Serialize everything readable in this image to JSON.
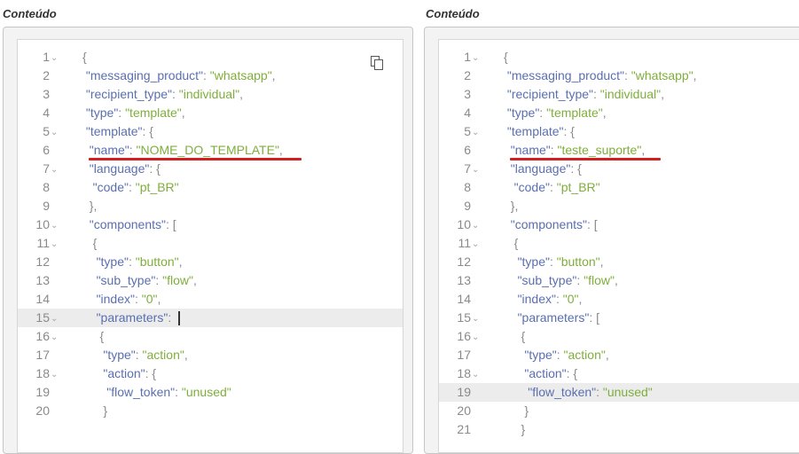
{
  "left": {
    "title": "Conteúdo",
    "highlight_line": 15,
    "lines": [
      {
        "n": "1",
        "fold": true,
        "parts": [
          [
            "p",
            "{"
          ]
        ]
      },
      {
        "n": "2",
        "fold": false,
        "parts": [
          [
            "p",
            " "
          ],
          [
            "k",
            "\"messaging_product\""
          ],
          [
            "p",
            ": "
          ],
          [
            "s",
            "\"whatsapp\""
          ],
          [
            "p",
            ","
          ]
        ]
      },
      {
        "n": "3",
        "fold": false,
        "parts": [
          [
            "p",
            " "
          ],
          [
            "k",
            "\"recipient_type\""
          ],
          [
            "p",
            ": "
          ],
          [
            "s",
            "\"individual\""
          ],
          [
            "p",
            ","
          ]
        ]
      },
      {
        "n": "4",
        "fold": false,
        "parts": [
          [
            "p",
            " "
          ],
          [
            "k",
            "\"type\""
          ],
          [
            "p",
            ": "
          ],
          [
            "s",
            "\"template\""
          ],
          [
            "p",
            ","
          ]
        ]
      },
      {
        "n": "5",
        "fold": true,
        "parts": [
          [
            "p",
            " "
          ],
          [
            "k",
            "\"template\""
          ],
          [
            "p",
            ": {"
          ]
        ]
      },
      {
        "n": "6",
        "fold": false,
        "parts": [
          [
            "p",
            "  "
          ],
          [
            "k",
            "\"name\""
          ],
          [
            "p",
            ": "
          ],
          [
            "s",
            "\"NOME_DO_TEMPLATE\""
          ],
          [
            "p",
            ","
          ]
        ]
      },
      {
        "n": "7",
        "fold": true,
        "parts": [
          [
            "p",
            "  "
          ],
          [
            "k",
            "\"language\""
          ],
          [
            "p",
            ": {"
          ]
        ]
      },
      {
        "n": "8",
        "fold": false,
        "parts": [
          [
            "p",
            "   "
          ],
          [
            "k",
            "\"code\""
          ],
          [
            "p",
            ": "
          ],
          [
            "s",
            "\"pt_BR\""
          ]
        ]
      },
      {
        "n": "9",
        "fold": false,
        "parts": [
          [
            "p",
            "  },"
          ]
        ]
      },
      {
        "n": "10",
        "fold": true,
        "parts": [
          [
            "p",
            "  "
          ],
          [
            "k",
            "\"components\""
          ],
          [
            "p",
            ": ["
          ]
        ]
      },
      {
        "n": "11",
        "fold": true,
        "parts": [
          [
            "p",
            "   {"
          ]
        ]
      },
      {
        "n": "12",
        "fold": false,
        "parts": [
          [
            "p",
            "    "
          ],
          [
            "k",
            "\"type\""
          ],
          [
            "p",
            ": "
          ],
          [
            "s",
            "\"button\""
          ],
          [
            "p",
            ","
          ]
        ]
      },
      {
        "n": "13",
        "fold": false,
        "parts": [
          [
            "p",
            "    "
          ],
          [
            "k",
            "\"sub_type\""
          ],
          [
            "p",
            ": "
          ],
          [
            "s",
            "\"flow\""
          ],
          [
            "p",
            ","
          ]
        ]
      },
      {
        "n": "14",
        "fold": false,
        "parts": [
          [
            "p",
            "    "
          ],
          [
            "k",
            "\"index\""
          ],
          [
            "p",
            ": "
          ],
          [
            "s",
            "\"0\""
          ],
          [
            "p",
            ","
          ]
        ]
      },
      {
        "n": "15",
        "fold": true,
        "parts": [
          [
            "p",
            "    "
          ],
          [
            "k",
            "\"parameters\""
          ],
          [
            "p",
            ": "
          ]
        ],
        "cursor": true
      },
      {
        "n": "16",
        "fold": true,
        "parts": [
          [
            "p",
            "     {"
          ]
        ]
      },
      {
        "n": "17",
        "fold": false,
        "parts": [
          [
            "p",
            "      "
          ],
          [
            "k",
            "\"type\""
          ],
          [
            "p",
            ": "
          ],
          [
            "s",
            "\"action\""
          ],
          [
            "p",
            ","
          ]
        ]
      },
      {
        "n": "18",
        "fold": true,
        "parts": [
          [
            "p",
            "      "
          ],
          [
            "k",
            "\"action\""
          ],
          [
            "p",
            ": {"
          ]
        ]
      },
      {
        "n": "19",
        "fold": false,
        "parts": [
          [
            "p",
            "       "
          ],
          [
            "k",
            "\"flow_token\""
          ],
          [
            "p",
            ": "
          ],
          [
            "s",
            "\"unused\""
          ]
        ]
      },
      {
        "n": "20",
        "fold": false,
        "parts": [
          [
            "p",
            "      }"
          ]
        ]
      }
    ]
  },
  "right": {
    "title": "Conteúdo",
    "highlight_line": 19,
    "lines": [
      {
        "n": "1",
        "fold": true,
        "parts": [
          [
            "p",
            "{"
          ]
        ]
      },
      {
        "n": "2",
        "fold": false,
        "parts": [
          [
            "p",
            " "
          ],
          [
            "k",
            "\"messaging_product\""
          ],
          [
            "p",
            ": "
          ],
          [
            "s",
            "\"whatsapp\""
          ],
          [
            "p",
            ","
          ]
        ]
      },
      {
        "n": "3",
        "fold": false,
        "parts": [
          [
            "p",
            " "
          ],
          [
            "k",
            "\"recipient_type\""
          ],
          [
            "p",
            ": "
          ],
          [
            "s",
            "\"individual\""
          ],
          [
            "p",
            ","
          ]
        ]
      },
      {
        "n": "4",
        "fold": false,
        "parts": [
          [
            "p",
            " "
          ],
          [
            "k",
            "\"type\""
          ],
          [
            "p",
            ": "
          ],
          [
            "s",
            "\"template\""
          ],
          [
            "p",
            ","
          ]
        ]
      },
      {
        "n": "5",
        "fold": true,
        "parts": [
          [
            "p",
            " "
          ],
          [
            "k",
            "\"template\""
          ],
          [
            "p",
            ": {"
          ]
        ]
      },
      {
        "n": "6",
        "fold": false,
        "parts": [
          [
            "p",
            "  "
          ],
          [
            "k",
            "\"name\""
          ],
          [
            "p",
            ": "
          ],
          [
            "s",
            "\"teste_suporte\""
          ],
          [
            "p",
            ","
          ]
        ]
      },
      {
        "n": "7",
        "fold": true,
        "parts": [
          [
            "p",
            "  "
          ],
          [
            "k",
            "\"language\""
          ],
          [
            "p",
            ": {"
          ]
        ]
      },
      {
        "n": "8",
        "fold": false,
        "parts": [
          [
            "p",
            "   "
          ],
          [
            "k",
            "\"code\""
          ],
          [
            "p",
            ": "
          ],
          [
            "s",
            "\"pt_BR\""
          ]
        ]
      },
      {
        "n": "9",
        "fold": false,
        "parts": [
          [
            "p",
            "  },"
          ]
        ]
      },
      {
        "n": "10",
        "fold": true,
        "parts": [
          [
            "p",
            "  "
          ],
          [
            "k",
            "\"components\""
          ],
          [
            "p",
            ": ["
          ]
        ]
      },
      {
        "n": "11",
        "fold": true,
        "parts": [
          [
            "p",
            "   {"
          ]
        ]
      },
      {
        "n": "12",
        "fold": false,
        "parts": [
          [
            "p",
            "    "
          ],
          [
            "k",
            "\"type\""
          ],
          [
            "p",
            ": "
          ],
          [
            "s",
            "\"button\""
          ],
          [
            "p",
            ","
          ]
        ]
      },
      {
        "n": "13",
        "fold": false,
        "parts": [
          [
            "p",
            "    "
          ],
          [
            "k",
            "\"sub_type\""
          ],
          [
            "p",
            ": "
          ],
          [
            "s",
            "\"flow\""
          ],
          [
            "p",
            ","
          ]
        ]
      },
      {
        "n": "14",
        "fold": false,
        "parts": [
          [
            "p",
            "    "
          ],
          [
            "k",
            "\"index\""
          ],
          [
            "p",
            ": "
          ],
          [
            "s",
            "\"0\""
          ],
          [
            "p",
            ","
          ]
        ]
      },
      {
        "n": "15",
        "fold": true,
        "parts": [
          [
            "p",
            "    "
          ],
          [
            "k",
            "\"parameters\""
          ],
          [
            "p",
            ": ["
          ]
        ]
      },
      {
        "n": "16",
        "fold": true,
        "parts": [
          [
            "p",
            "     {"
          ]
        ]
      },
      {
        "n": "17",
        "fold": false,
        "parts": [
          [
            "p",
            "      "
          ],
          [
            "k",
            "\"type\""
          ],
          [
            "p",
            ": "
          ],
          [
            "s",
            "\"action\""
          ],
          [
            "p",
            ","
          ]
        ]
      },
      {
        "n": "18",
        "fold": true,
        "parts": [
          [
            "p",
            "      "
          ],
          [
            "k",
            "\"action\""
          ],
          [
            "p",
            ": {"
          ]
        ]
      },
      {
        "n": "19",
        "fold": false,
        "parts": [
          [
            "p",
            "       "
          ],
          [
            "k",
            "\"flow_token\""
          ],
          [
            "p",
            ": "
          ],
          [
            "s",
            "\"unused\""
          ]
        ]
      },
      {
        "n": "20",
        "fold": false,
        "parts": [
          [
            "p",
            "      }"
          ]
        ]
      },
      {
        "n": "21",
        "fold": false,
        "parts": [
          [
            "p",
            "     }"
          ]
        ]
      }
    ]
  },
  "icons": {
    "copy": "copy-icon",
    "fold": "chevron-down-icon"
  },
  "colors": {
    "key": "#5a6fb0",
    "string": "#7fae3c",
    "annotation": "#d21f1f"
  }
}
